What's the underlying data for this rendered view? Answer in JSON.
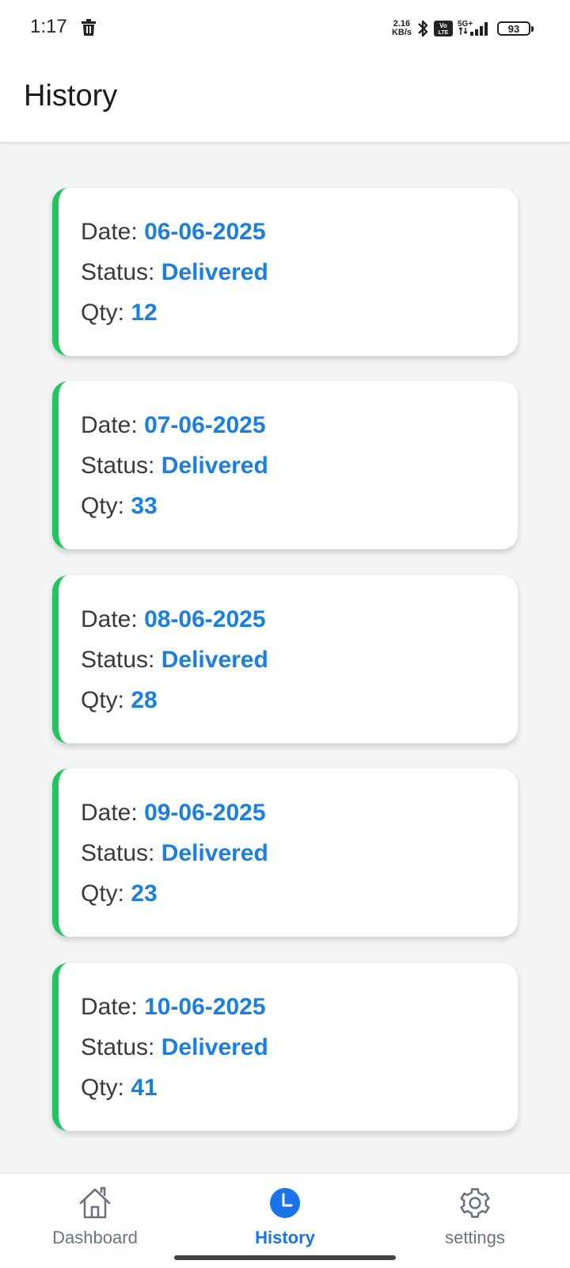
{
  "status_bar": {
    "time": "1:17",
    "net_speed_value": "2.16",
    "net_speed_unit": "KB/s",
    "volte": "Vo LTE",
    "network": "5G+",
    "battery": "93"
  },
  "header": {
    "title": "History"
  },
  "history": {
    "items": [
      {
        "date_label": "Date:",
        "date": "06-06-2025",
        "status_label": "Status:",
        "status": "Delivered",
        "qty_label": "Qty:",
        "qty": "12"
      },
      {
        "date_label": "Date:",
        "date": "07-06-2025",
        "status_label": "Status:",
        "status": "Delivered",
        "qty_label": "Qty:",
        "qty": "33"
      },
      {
        "date_label": "Date:",
        "date": "08-06-2025",
        "status_label": "Status:",
        "status": "Delivered",
        "qty_label": "Qty:",
        "qty": "28"
      },
      {
        "date_label": "Date:",
        "date": "09-06-2025",
        "status_label": "Status:",
        "status": "Delivered",
        "qty_label": "Qty:",
        "qty": "23"
      },
      {
        "date_label": "Date:",
        "date": "10-06-2025",
        "status_label": "Status:",
        "status": "Delivered",
        "qty_label": "Qty:",
        "qty": "41"
      }
    ]
  },
  "bottom_nav": {
    "items": [
      {
        "label": "Dashboard",
        "icon": "home-icon",
        "active": false
      },
      {
        "label": "History",
        "icon": "clock-icon",
        "active": true
      },
      {
        "label": "settings",
        "icon": "gear-icon",
        "active": false
      }
    ]
  },
  "colors": {
    "accent": "#1a7fe0",
    "card_border": "#22c55e",
    "background": "#f3f4f6"
  }
}
